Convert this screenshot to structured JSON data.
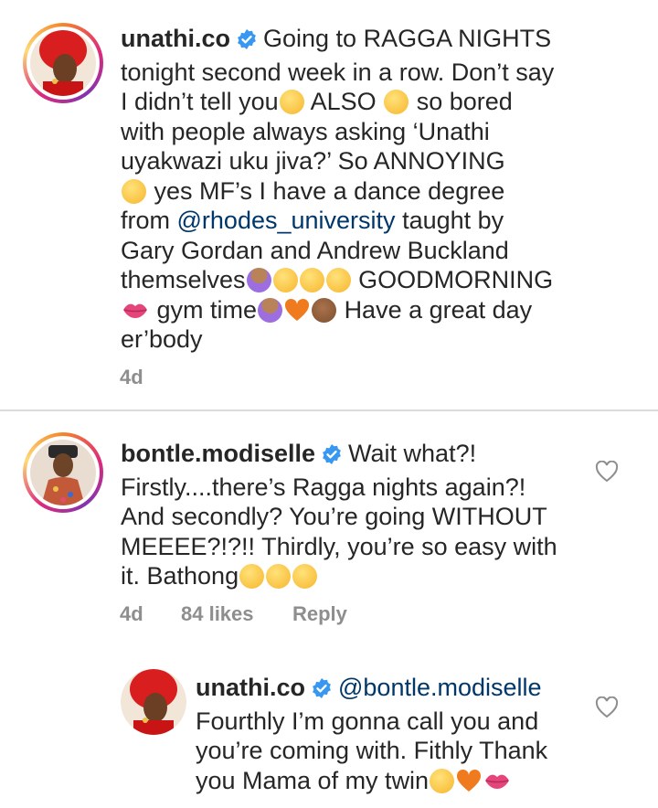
{
  "caption": {
    "username": "unathi.co",
    "lines": [
      "Going to RAGGA NIGHTS",
      "tonight second week in a row. Don’t say",
      "I didn’t tell you",
      "ALSO",
      "so bored",
      "with people always asking ‘Unathi",
      "uyakwazi uku jiva?’ So ANNOYING",
      "yes MF’s I have a dance degree",
      "from",
      "@rhodes_university",
      "taught by",
      "Gary Gordan and Andrew Buckland",
      "themselves",
      "GOODMORNING",
      "gym time",
      "Have a great day",
      "er’body"
    ],
    "time": "4d"
  },
  "comment1": {
    "username": "bontle.modiselle",
    "lines": [
      "Wait what?!",
      "Firstly....there’s Ragga nights again?!",
      "And secondly? You’re going WITHOUT",
      "MEEEE?!?!! Thirdly, you’re so easy with",
      "it. Bathong"
    ],
    "time": "4d",
    "likes": "84 likes",
    "reply": "Reply"
  },
  "reply1": {
    "username": "unathi.co",
    "mention": "@bontle.modiselle",
    "lines": [
      "Fourthly I’m gonna call you and",
      "you’re coming with. Fithly Thank",
      "you Mama of my twin"
    ]
  },
  "icons": {
    "verified": "verified-badge-icon",
    "like": "heart-outline-icon"
  },
  "colors": {
    "mention": "#00376b",
    "verified": "#3897f0",
    "meta": "#8e8e8e",
    "divider": "#dbdbdb"
  }
}
